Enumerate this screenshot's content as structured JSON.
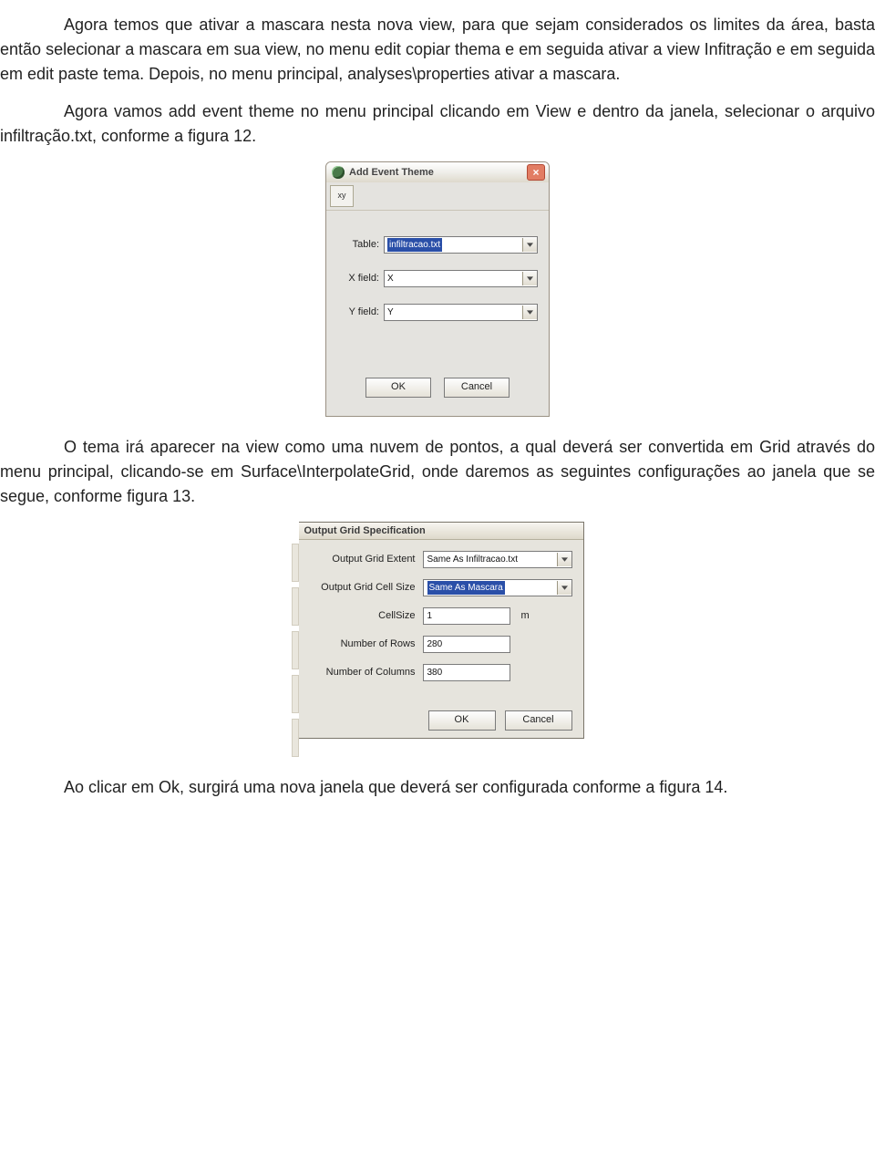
{
  "para1": "Agora temos que ativar a mascara nesta nova view, para que sejam considerados os limites da área, basta então selecionar a mascara em sua view, no menu edit copiar thema e em seguida ativar a view Infitração e em seguida em edit paste tema. Depois, no menu principal, analyses\\properties ativar a mascara.",
  "para2": "Agora vamos add event theme no menu principal clicando em View e dentro da janela, selecionar o arquivo infiltração.txt, conforme a figura 12.",
  "para3": "O tema irá aparecer na view como uma nuvem de pontos, a qual deverá ser convertida em Grid através do menu principal, clicando-se em Surface\\InterpolateGrid, onde daremos as seguintes configurações ao janela que se segue, conforme figura 13.",
  "para4": "Ao clicar em Ok, surgirá uma nova janela que deverá ser configurada conforme a figura 14.",
  "dialog1": {
    "title": "Add Event Theme",
    "toolbar_btn": "xy",
    "close": "×",
    "table_label": "Table:",
    "table_value": "infiltracao.txt",
    "x_label": "X field:",
    "x_value": "X",
    "y_label": "Y field:",
    "y_value": "Y",
    "ok": "OK",
    "cancel": "Cancel"
  },
  "dialog2": {
    "title": "Output Grid Specification",
    "extent_label": "Output Grid Extent",
    "extent_value": "Same As Infiltracao.txt",
    "cellsize_sel_label": "Output Grid Cell Size",
    "cellsize_sel_value": "Same As Mascara",
    "cellsize_label": "CellSize",
    "cellsize_value": "1",
    "cellsize_unit": "m",
    "rows_label": "Number of Rows",
    "rows_value": "280",
    "cols_label": "Number of Columns",
    "cols_value": "380",
    "ok": "OK",
    "cancel": "Cancel"
  }
}
